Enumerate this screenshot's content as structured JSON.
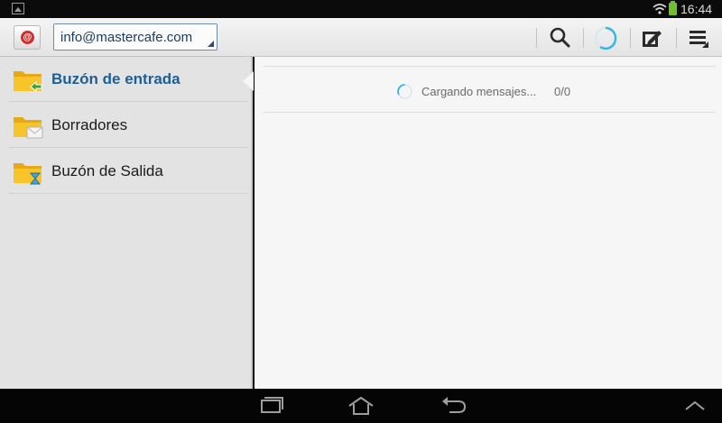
{
  "status_bar": {
    "time": "16:44",
    "icons": [
      "image-thumbnail-icon",
      "wifi-icon",
      "battery-icon"
    ],
    "battery_color": "#6fbf2a"
  },
  "action_bar": {
    "app_icon": "email-at-icon",
    "account": "info@mastercafe.com",
    "actions": [
      {
        "name": "search-icon"
      },
      {
        "name": "refresh-spinner-icon"
      },
      {
        "name": "compose-icon"
      },
      {
        "name": "overflow-menu-icon"
      }
    ]
  },
  "folders": [
    {
      "label": "Buzón de entrada",
      "icon": "inbox-folder-icon",
      "selected": true
    },
    {
      "label": "Borradores",
      "icon": "drafts-folder-icon",
      "selected": false
    },
    {
      "label": "Buzón de Salida",
      "icon": "outbox-folder-icon",
      "selected": false
    }
  ],
  "message_list": {
    "loading_text": "Cargando mensajes...",
    "count": "0/0"
  },
  "nav_bar": {
    "buttons": [
      "recent-apps-icon",
      "home-icon",
      "back-icon",
      "expand-up-icon"
    ]
  },
  "colors": {
    "selected_folder": "#1d5f95",
    "account_text": "#1c3e63",
    "spinner_accent": "#33b5e5",
    "folder_yellow": "#f5b719"
  }
}
